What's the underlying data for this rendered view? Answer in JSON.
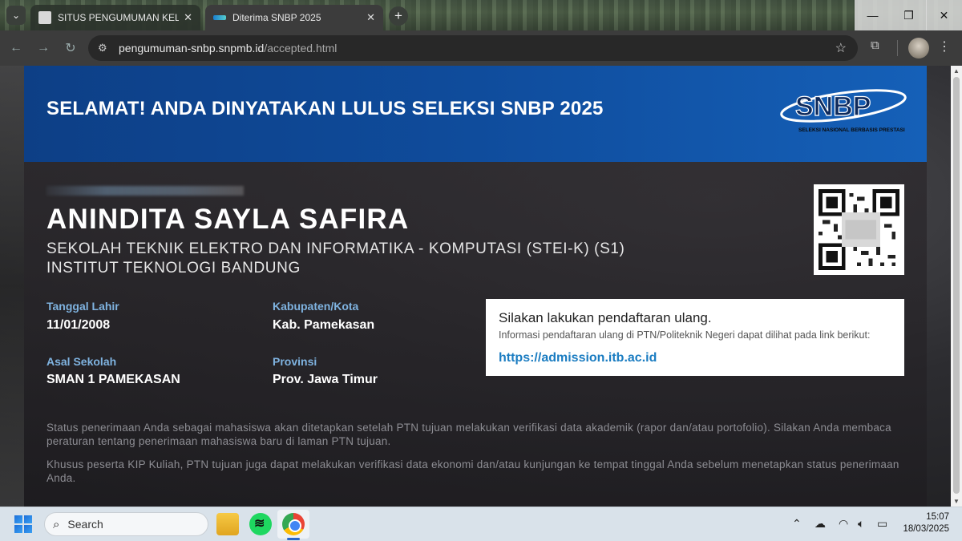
{
  "browser": {
    "tabs": [
      {
        "title": "SITUS PENGUMUMAN KELULUSAN",
        "active": false
      },
      {
        "title": "Diterima SNBP 2025",
        "active": true
      }
    ],
    "address": {
      "host": "pengumuman-snbp.snpmb.id",
      "path": "/accepted.html"
    }
  },
  "banner": {
    "title": "SELAMAT! ANDA DINYATAKAN LULUS SELEKSI SNBP 2025",
    "logo_text": "SNBP",
    "logo_subtitle": "SELEKSI NASIONAL BERBASIS PRESTASI"
  },
  "student": {
    "name": "ANINDITA SAYLA SAFIRA",
    "program": "SEKOLAH TEKNIK ELEKTRO DAN INFORMATIKA - KOMPUTASI (STEI-K) (S1)",
    "university": "INSTITUT TEKNOLOGI BANDUNG"
  },
  "fields": {
    "birth_label": "Tanggal Lahir",
    "birth_value": "11/01/2008",
    "city_label": "Kabupaten/Kota",
    "city_value": "Kab. Pamekasan",
    "school_label": "Asal Sekolah",
    "school_value": "SMAN 1 PAMEKASAN",
    "province_label": "Provinsi",
    "province_value": "Prov. Jawa Timur"
  },
  "reregistration": {
    "heading": "Silakan lakukan pendaftaran ulang.",
    "subtext": "Informasi pendaftaran ulang di PTN/Politeknik Negeri dapat dilihat pada link berikut:",
    "link": "https://admission.itb.ac.id"
  },
  "notes": [
    "Status penerimaan Anda sebagai mahasiswa akan ditetapkan setelah PTN tujuan melakukan verifikasi data akademik (rapor dan/atau portofolio). Silakan Anda membaca peraturan tentang penerimaan mahasiswa baru di laman PTN tujuan.",
    "Khusus peserta KIP Kuliah, PTN tujuan juga dapat melakukan verifikasi data ekonomi dan/atau kunjungan ke tempat tinggal Anda sebelum menetapkan status penerimaan Anda."
  ],
  "taskbar": {
    "search_placeholder": "Search",
    "time": "15:07",
    "date": "18/03/2025"
  },
  "icons": [
    "chevron-down-icon",
    "close-icon",
    "plus-icon",
    "back-icon",
    "forward-icon",
    "reload-icon",
    "tune-icon",
    "star-icon",
    "extensions-icon",
    "kebab-icon",
    "windows-icon",
    "search-icon",
    "chevron-up-icon",
    "cloud-icon",
    "wifi-icon",
    "speaker-icon",
    "battery-icon"
  ]
}
